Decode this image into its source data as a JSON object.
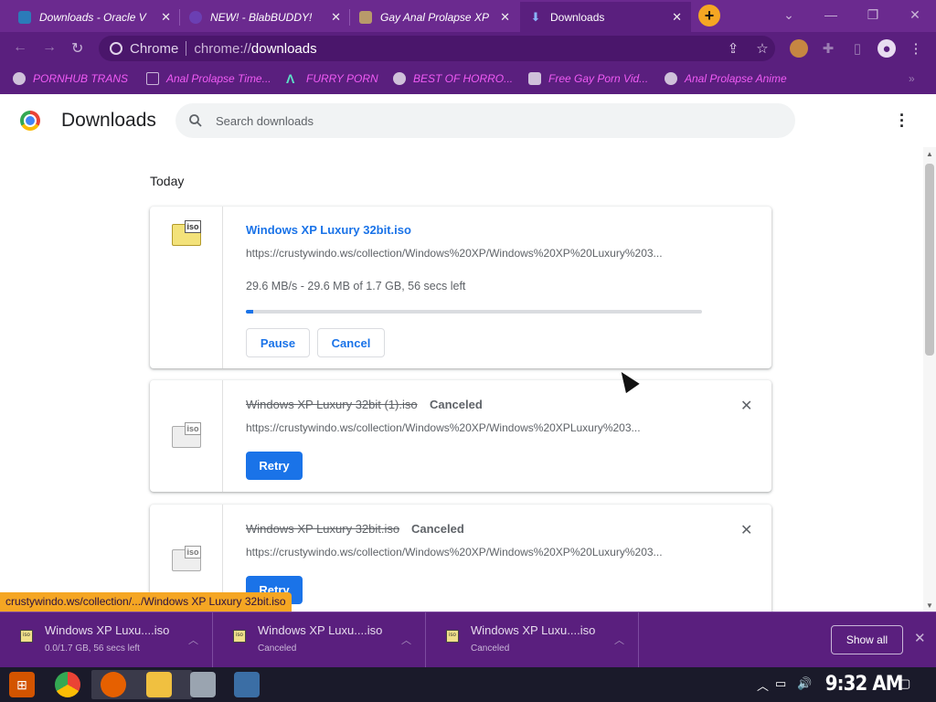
{
  "tabs": [
    {
      "title": "Downloads - Oracle V",
      "color": "#2b7bb9"
    },
    {
      "title": "NEW! - BlabBUDDY!",
      "color": "#6b3fb3"
    },
    {
      "title": "Gay Anal Prolapse XP",
      "color": "#b89a6a"
    },
    {
      "title": "Downloads",
      "color": "#1a73e8"
    }
  ],
  "toolbar": {
    "site_chip": "Chrome",
    "url_scheme": "chrome://",
    "url_path": "downloads"
  },
  "bookmarks": [
    {
      "label": "PORNHUB TRANS"
    },
    {
      "label": "Anal Prolapse Time..."
    },
    {
      "label": "FURRY PORN"
    },
    {
      "label": "BEST OF HORRO..."
    },
    {
      "label": "Free Gay Porn Vid..."
    },
    {
      "label": "Anal Prolapse Anime"
    }
  ],
  "header": {
    "title": "Downloads",
    "search_placeholder": "Search downloads"
  },
  "section_label": "Today",
  "downloads": [
    {
      "name": "Windows XP Luxury 32bit.iso",
      "url": "https://crustywindo.ws/collection/Windows%20XP/Windows%20XP%20Luxury%203...",
      "progress_text": "29.6 MB/s - 29.6 MB of 1.7 GB, 56 secs left",
      "progress": 0.017,
      "pause_label": "Pause",
      "cancel_label": "Cancel"
    },
    {
      "name": "Windows XP Luxury 32bit (1).iso",
      "status": "Canceled",
      "url": "https://crustywindo.ws/collection/Windows%20XP/Windows%20XPLuxury%203...",
      "retry_label": "Retry"
    },
    {
      "name": "Windows XP Luxury 32bit.iso",
      "status": "Canceled",
      "url": "https://crustywindo.ws/collection/Windows%20XP/Windows%20XP%20Luxury%203...",
      "retry_label": "Retry"
    }
  ],
  "hover_url": "crustywindo.ws/collection/.../Windows XP Luxury 32bit.iso",
  "shelf": {
    "items": [
      {
        "name": "Windows XP Luxu....iso",
        "sub": "0.0/1.7 GB, 56 secs left"
      },
      {
        "name": "Windows XP Luxu....iso",
        "sub": "Canceled"
      },
      {
        "name": "Windows XP Luxu....iso",
        "sub": "Canceled"
      }
    ],
    "show_all": "Show all"
  },
  "taskbar": {
    "clock": "9:32 AM"
  },
  "colors": {
    "chrome_theme": "#5a1f7e",
    "accent": "#1a73e8",
    "bookmark_text": "#f05bf5",
    "tooltip": "#f5a623"
  }
}
